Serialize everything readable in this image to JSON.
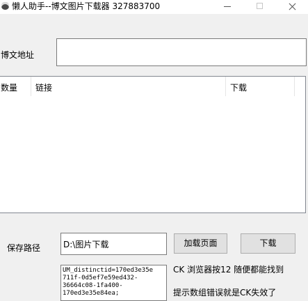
{
  "window": {
    "title": "懒人助手--博文图片下载器  327883700"
  },
  "form": {
    "url_label": "博文地址",
    "url_value": "",
    "save_path_label": "保存路径",
    "save_path_value": "D:\\图片下载",
    "load_page_button": "加载页面",
    "download_button": "下载"
  },
  "table": {
    "columns": [
      "数量",
      "链接",
      "下载"
    ],
    "rows": []
  },
  "cookie": {
    "value_lines": [
      "UM_distinctid=170ed3e35e",
      "711f-0d5ef7e59ed432-",
      "36664c08-1fa400-",
      "170ed3e35e84ea;"
    ],
    "hint_1": "CK 浏览器按12 随便都能找到",
    "hint_2": "提示数组错误就是CK失效了"
  }
}
